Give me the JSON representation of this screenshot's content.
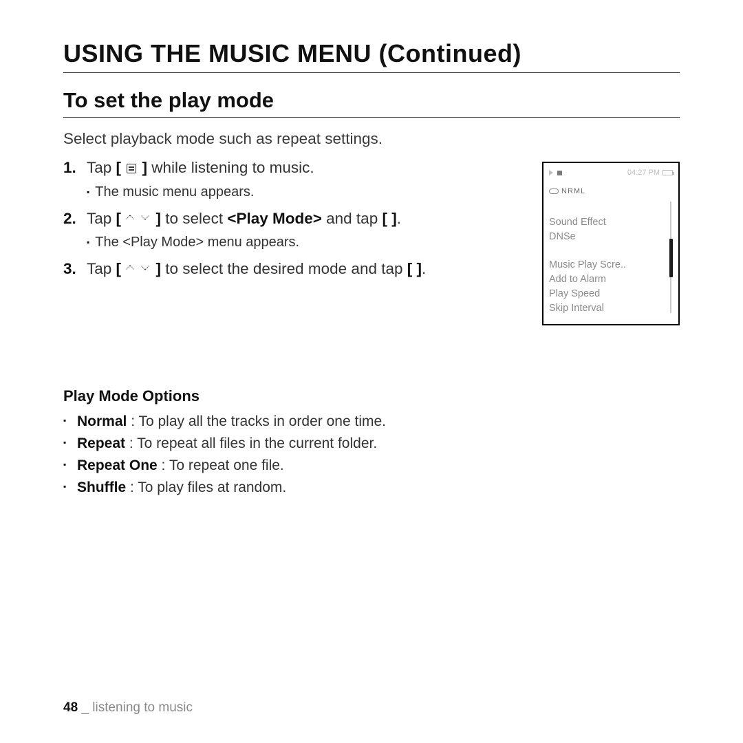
{
  "heading": "USING THE MUSIC MENU (Continued)",
  "subheading": "To set the play mode",
  "intro": "Select playback mode such as repeat settings.",
  "steps": {
    "s1": {
      "pre": "Tap ",
      "icon_label": "menu-button-icon",
      "post": " while listening to music.",
      "sub": "The music menu appears."
    },
    "s2": {
      "pre": "Tap ",
      "mid1": " to select ",
      "bold": "<Play Mode>",
      "mid2": " and tap ",
      "bracket_open": "[   ",
      "bracket_close": "]",
      "end": ".",
      "sub": "The <Play Mode> menu appears."
    },
    "s3": {
      "pre": "Tap ",
      "mid": " to select the desired mode and tap ",
      "bracket_open": "[   ",
      "bracket_close": "]",
      "end": "."
    }
  },
  "device": {
    "time": "04:27 PM",
    "mode_label": "NRML",
    "menu": [
      "Sound Effect",
      "DNSe",
      "",
      "Music Play Scre..",
      "Add to Alarm",
      "Play Speed",
      "Skip Interval"
    ]
  },
  "options": {
    "title": "Play Mode Options",
    "items": [
      {
        "name": "Normal",
        "desc": " : To play all the tracks in order one time."
      },
      {
        "name": "Repeat",
        "desc": " : To repeat all files in the current folder."
      },
      {
        "name": "Repeat One",
        "desc": " : To repeat one file."
      },
      {
        "name": "Shuffle",
        "desc": " : To play files at random."
      }
    ]
  },
  "footer": {
    "page": "48",
    "sep": " _ ",
    "section": "listening to music"
  }
}
